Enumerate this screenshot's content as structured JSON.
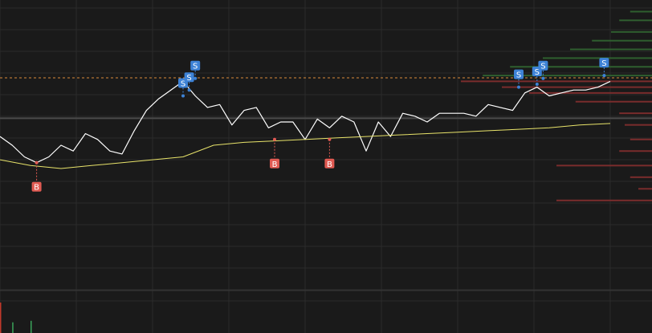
{
  "header": {
    "caption": ""
  },
  "colors": {
    "background": "#1a1a1a",
    "grid": "#2b2b2b",
    "price_line": "#ffffff",
    "moving_average": "#e8e36a",
    "reference_line": "#d98a3a",
    "mid_line": "#4a4a4a",
    "buy_marker": "#e05a52",
    "sell_marker": "#3d82d6",
    "bid_depth": "#2f5f2f",
    "ask_depth": "#7a2c2c",
    "volume_up": "#3aa35a",
    "volume_down": "#c0392b"
  },
  "chart_data": {
    "type": "line",
    "title": "",
    "xlabel": "",
    "ylabel": "",
    "ylim": [
      0,
      100
    ],
    "grid": true,
    "reference_level": 73.2,
    "mid_level": 59.3,
    "series": [
      {
        "name": "",
        "role": "price",
        "x": [
          0,
          2,
          4,
          6,
          8,
          10,
          12,
          14,
          16,
          18,
          20,
          22,
          24,
          26,
          28,
          30,
          32,
          34,
          36,
          38,
          40,
          42,
          44,
          46,
          48,
          50,
          52,
          54,
          56,
          58,
          60,
          62,
          64,
          66,
          68,
          70,
          72,
          74,
          76,
          78,
          80,
          82,
          84,
          86,
          88,
          90,
          92,
          94,
          96,
          98,
          100
        ],
        "values": [
          53,
          50,
          46,
          44,
          46,
          50,
          48,
          54,
          52,
          48,
          47,
          55,
          62,
          66,
          69,
          72,
          67,
          63,
          64,
          57,
          62,
          63,
          56,
          58,
          58,
          52,
          59,
          56,
          60,
          58,
          48,
          58,
          53,
          61,
          60,
          58,
          61,
          61,
          61,
          60,
          64,
          63,
          62,
          68,
          70,
          67,
          68,
          69,
          69,
          70,
          72
        ]
      },
      {
        "name": "",
        "role": "moving-average",
        "x": [
          0,
          5,
          10,
          15,
          20,
          25,
          30,
          35,
          40,
          45,
          50,
          55,
          60,
          65,
          70,
          75,
          80,
          85,
          90,
          95,
          100
        ],
        "values": [
          45,
          43,
          42,
          43,
          44,
          45,
          46,
          50,
          51,
          51.5,
          52,
          52.5,
          53,
          53.5,
          54,
          54.5,
          55,
          55.5,
          56,
          57,
          57.5
        ]
      }
    ],
    "markers": [
      {
        "label": "B",
        "x": 6,
        "y": 44,
        "side": "buy"
      },
      {
        "label": "B",
        "x": 45,
        "y": 52,
        "side": "buy"
      },
      {
        "label": "B",
        "x": 54,
        "y": 52,
        "side": "buy"
      },
      {
        "label": "S",
        "x": 30,
        "y": 67,
        "side": "sell"
      },
      {
        "label": "S",
        "x": 31,
        "y": 69,
        "side": "sell"
      },
      {
        "label": "S",
        "x": 32,
        "y": 73,
        "side": "sell"
      },
      {
        "label": "S",
        "x": 85,
        "y": 70,
        "side": "sell"
      },
      {
        "label": "S",
        "x": 88,
        "y": 71,
        "side": "sell"
      },
      {
        "label": "S",
        "x": 89,
        "y": 73,
        "side": "sell"
      },
      {
        "label": "S",
        "x": 99,
        "y": 74,
        "side": "sell"
      }
    ],
    "depth": {
      "bids": [
        {
          "price": 96,
          "size": 0.08
        },
        {
          "price": 93,
          "size": 0.12
        },
        {
          "price": 89,
          "size": 0.15
        },
        {
          "price": 86,
          "size": 0.22
        },
        {
          "price": 83,
          "size": 0.3
        },
        {
          "price": 80,
          "size": 0.4
        },
        {
          "price": 77,
          "size": 0.52
        },
        {
          "price": 74,
          "size": 0.62
        }
      ],
      "asks": [
        {
          "price": 72,
          "size": 0.7
        },
        {
          "price": 70,
          "size": 0.55
        },
        {
          "price": 68,
          "size": 0.45
        },
        {
          "price": 65,
          "size": 0.28
        },
        {
          "price": 61,
          "size": 0.12
        },
        {
          "price": 57,
          "size": 0.1
        },
        {
          "price": 52,
          "size": 0.08
        },
        {
          "price": 48,
          "size": 0.12
        },
        {
          "price": 43,
          "size": 0.35
        },
        {
          "price": 39,
          "size": 0.08
        },
        {
          "price": 35,
          "size": 0.05
        },
        {
          "price": 31,
          "size": 0.35
        }
      ]
    },
    "volume": [
      {
        "x": 0,
        "value": 1.0,
        "dir": "down"
      },
      {
        "x": 2,
        "value": 0.35,
        "dir": "up"
      },
      {
        "x": 5,
        "value": 0.4,
        "dir": "up"
      }
    ]
  }
}
